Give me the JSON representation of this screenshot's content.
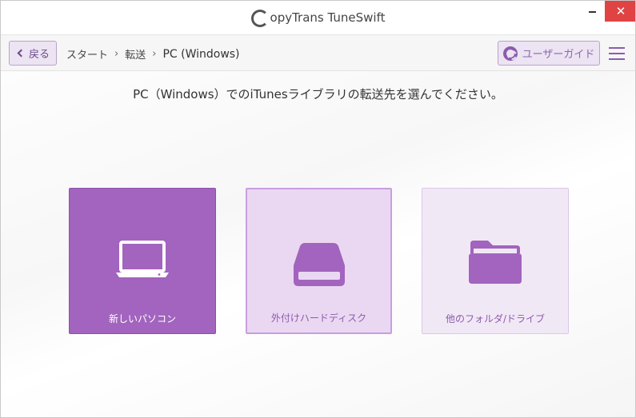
{
  "window": {
    "title_logo_letter": "C",
    "title": "opyTrans TuneSwift",
    "close_symbol": "✕"
  },
  "nav": {
    "back_label": "戻る",
    "breadcrumb": [
      "スタート",
      "転送",
      "PC (Windows)"
    ],
    "breadcrumb_separator": "›",
    "guide_label": "ユーザーガイド"
  },
  "main": {
    "heading": "PC（Windows）でのiTunesライブラリの転送先を選んでください。",
    "tiles": [
      {
        "label": "新しいパソコン",
        "icon": "laptop-icon"
      },
      {
        "label": "外付けハードディスク",
        "icon": "hard-drive-icon"
      },
      {
        "label": "他のフォルダ/ドライブ",
        "icon": "folder-icon"
      }
    ]
  },
  "colors": {
    "accent": "#a264be",
    "accent_light": "#ead8f2",
    "close_red": "#e04343"
  }
}
